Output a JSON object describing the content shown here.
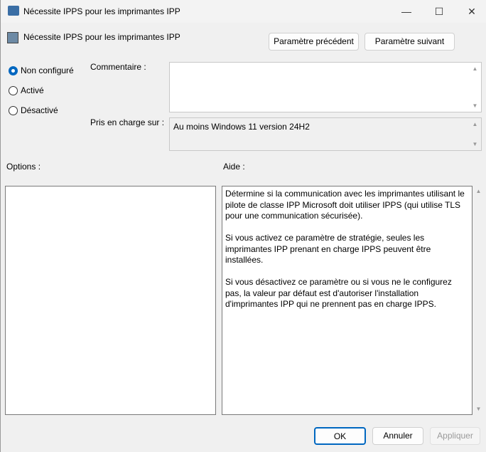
{
  "window": {
    "title": "Nécessite IPPS pour les imprimantes IPP",
    "minimize": "—",
    "maximize": "☐",
    "close": "✕"
  },
  "header": {
    "policy_name": "Nécessite IPPS pour les imprimantes IPP",
    "prev_button": "Paramètre précédent",
    "next_button": "Paramètre suivant"
  },
  "state": {
    "options": [
      {
        "label": "Non configuré",
        "selected": true
      },
      {
        "label": "Activé",
        "selected": false
      },
      {
        "label": "Désactivé",
        "selected": false
      }
    ]
  },
  "comment": {
    "label": "Commentaire :",
    "value": ""
  },
  "supported": {
    "label": "Pris en charge sur :",
    "value": "Au moins Windows 11 version 24H2"
  },
  "options_label": "Options :",
  "help": {
    "label": "Aide :",
    "text": "Détermine si la communication avec les imprimantes utilisant le pilote de classe IPP Microsoft doit utiliser IPPS (qui utilise TLS pour une communication sécurisée).\n\nSi vous activez ce paramètre de stratégie, seules les imprimantes IPP prenant en charge IPPS peuvent être installées.\n\nSi vous désactivez ce paramètre ou si vous ne le configurez pas, la valeur par défaut est d'autoriser l'installation d'imprimantes IPP qui ne prennent pas en charge IPPS."
  },
  "footer": {
    "ok": "OK",
    "cancel": "Annuler",
    "apply": "Appliquer"
  }
}
